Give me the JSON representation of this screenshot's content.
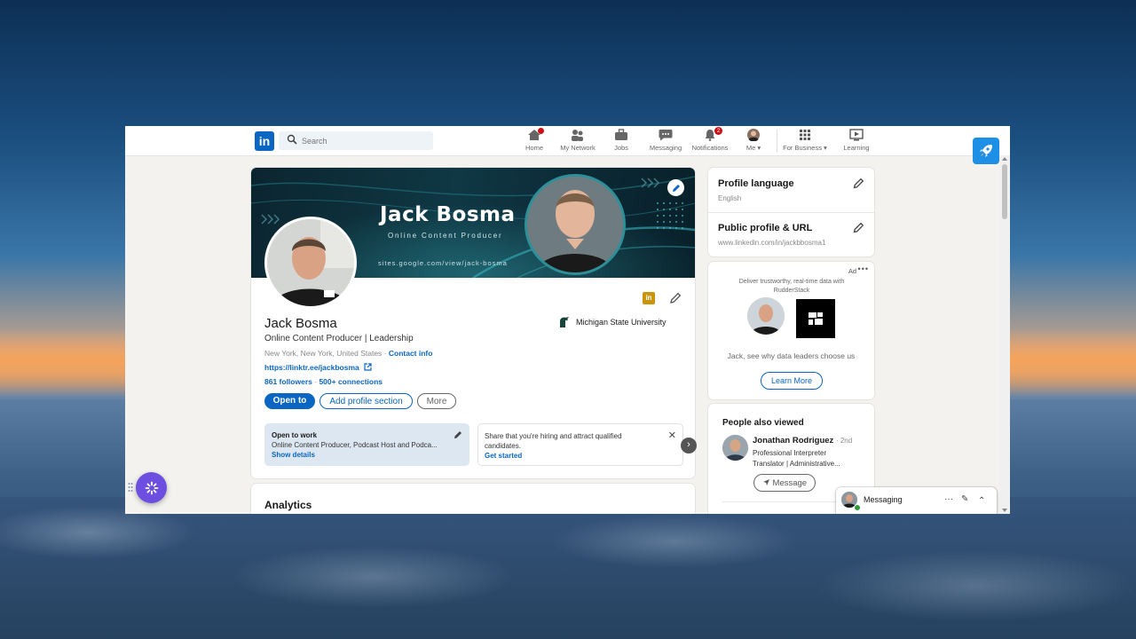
{
  "nav": {
    "logo": "in",
    "search_placeholder": "Search",
    "items": [
      {
        "label": "Home",
        "icon": "home-icon",
        "badge": ""
      },
      {
        "label": "My Network",
        "icon": "network-icon",
        "badge": ""
      },
      {
        "label": "Jobs",
        "icon": "briefcase-icon",
        "badge": ""
      },
      {
        "label": "Messaging",
        "icon": "chat-icon",
        "badge": ""
      },
      {
        "label": "Notifications",
        "icon": "bell-icon",
        "badge": "2"
      },
      {
        "label": "Me",
        "icon": "avatar",
        "badge": ""
      },
      {
        "label": "For Business",
        "icon": "grid-icon",
        "badge": ""
      },
      {
        "label": "Learning",
        "icon": "play-icon",
        "badge": ""
      }
    ]
  },
  "profile": {
    "banner_name": "Jack Bosma",
    "banner_subtitle": "Online Content Producer",
    "banner_url": "sites.google.com/view/jack-bosma",
    "name": "Jack Bosma",
    "headline": "Online Content Producer | Leadership",
    "location": "New York, New York, United States",
    "contact_info": "Contact info",
    "website": "https://linktr.ee/jackbosma",
    "followers": "861 followers",
    "connections": "500+ connections",
    "school": "Michigan State University",
    "li_badge": "in",
    "buttons": {
      "open_to": "Open to",
      "add_section": "Add profile section",
      "more": "More"
    },
    "open_to_work": {
      "title": "Open to work",
      "desc": "Online Content Producer, Podcast Host and Podca...",
      "link": "Show details"
    },
    "hiring": {
      "desc": "Share that you're hiring and attract qualified candidates.",
      "link": "Get started",
      "close": "✕"
    },
    "next": "›"
  },
  "analytics": {
    "title": "Analytics"
  },
  "sidebar": {
    "profile_language": {
      "title": "Profile language",
      "value": "English"
    },
    "public_profile": {
      "title": "Public profile & URL",
      "value": "www.linkedin.com/in/jackbbosma1"
    },
    "ad": {
      "label": "Ad",
      "menu": "•••",
      "desc": "Deliver trustworthy, real-time data with RudderStack",
      "cta": "Jack, see why data leaders choose us",
      "button": "Learn More"
    },
    "people_also_viewed": {
      "title": "People also viewed",
      "person": {
        "name": "Jonathan Rodriguez",
        "degree": "· 2nd",
        "title": "Professional Interpreter Translator | Administrative..."
      },
      "message_button": "Message"
    }
  },
  "messaging": {
    "label": "Messaging",
    "more": "···",
    "compose": "✎",
    "collapse": "⌃"
  },
  "colors": {
    "brand": "#0a66c2",
    "badge": "#cc1016"
  }
}
